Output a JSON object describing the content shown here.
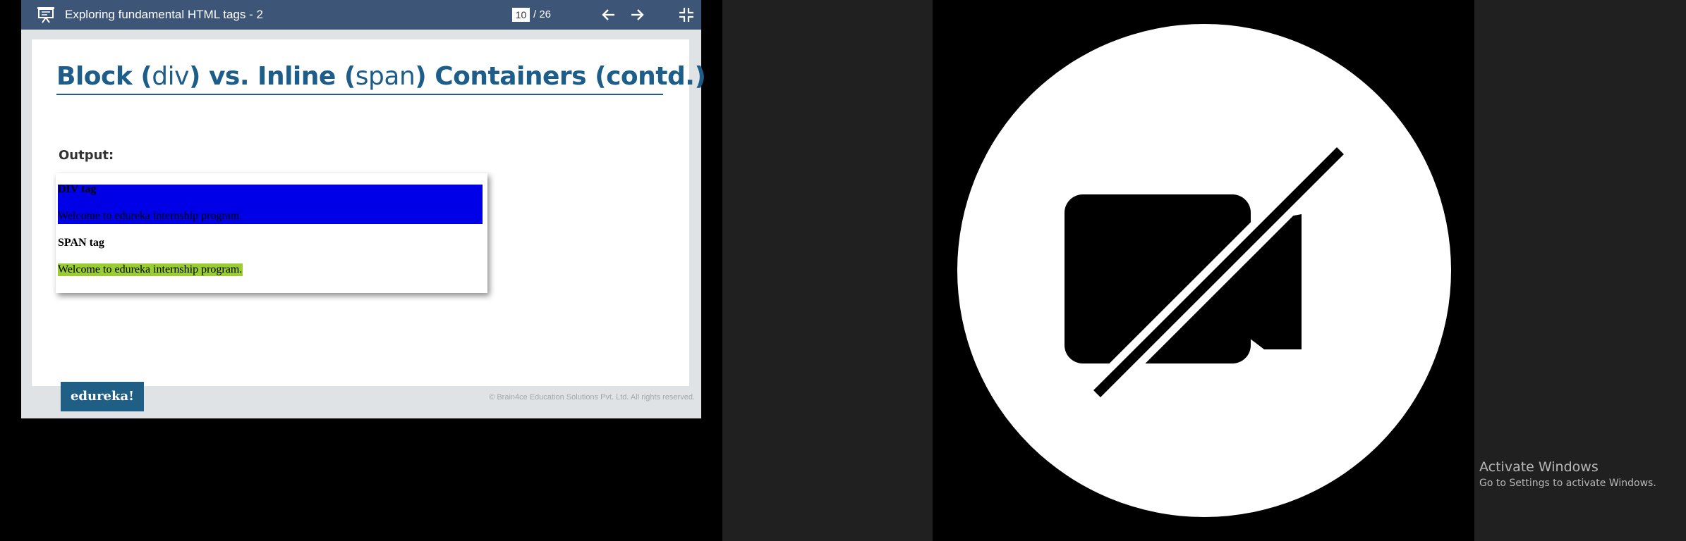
{
  "viewer": {
    "deck_title": "Exploring fundamental HTML tags - 2",
    "current_page": "10",
    "page_total": "/ 26"
  },
  "slide": {
    "title_part1": "Block (",
    "title_div": "div",
    "title_part2": ")  vs. Inline (",
    "title_span": "span",
    "title_part3": ")  Containers (contd.)",
    "output_label": "Output:",
    "div_heading": "DIV tag",
    "div_text": "Welcome to edureka internship program.",
    "span_heading": "SPAN tag",
    "span_text": "Welcome to edureka internship program.",
    "brand": "edureka!",
    "copyright": "© Brain4ce Education Solutions Pvt. Ltd. All rights reserved."
  },
  "video": {
    "icon": "camera-off-icon"
  },
  "watermark": {
    "title": "Activate Windows",
    "subtitle": "Go to Settings to activate Windows."
  },
  "colors": {
    "toolbar": "#3d5576",
    "title_blue": "#1d5d8a",
    "div_background": "#0000e6",
    "span_highlight": "#9acd32"
  }
}
